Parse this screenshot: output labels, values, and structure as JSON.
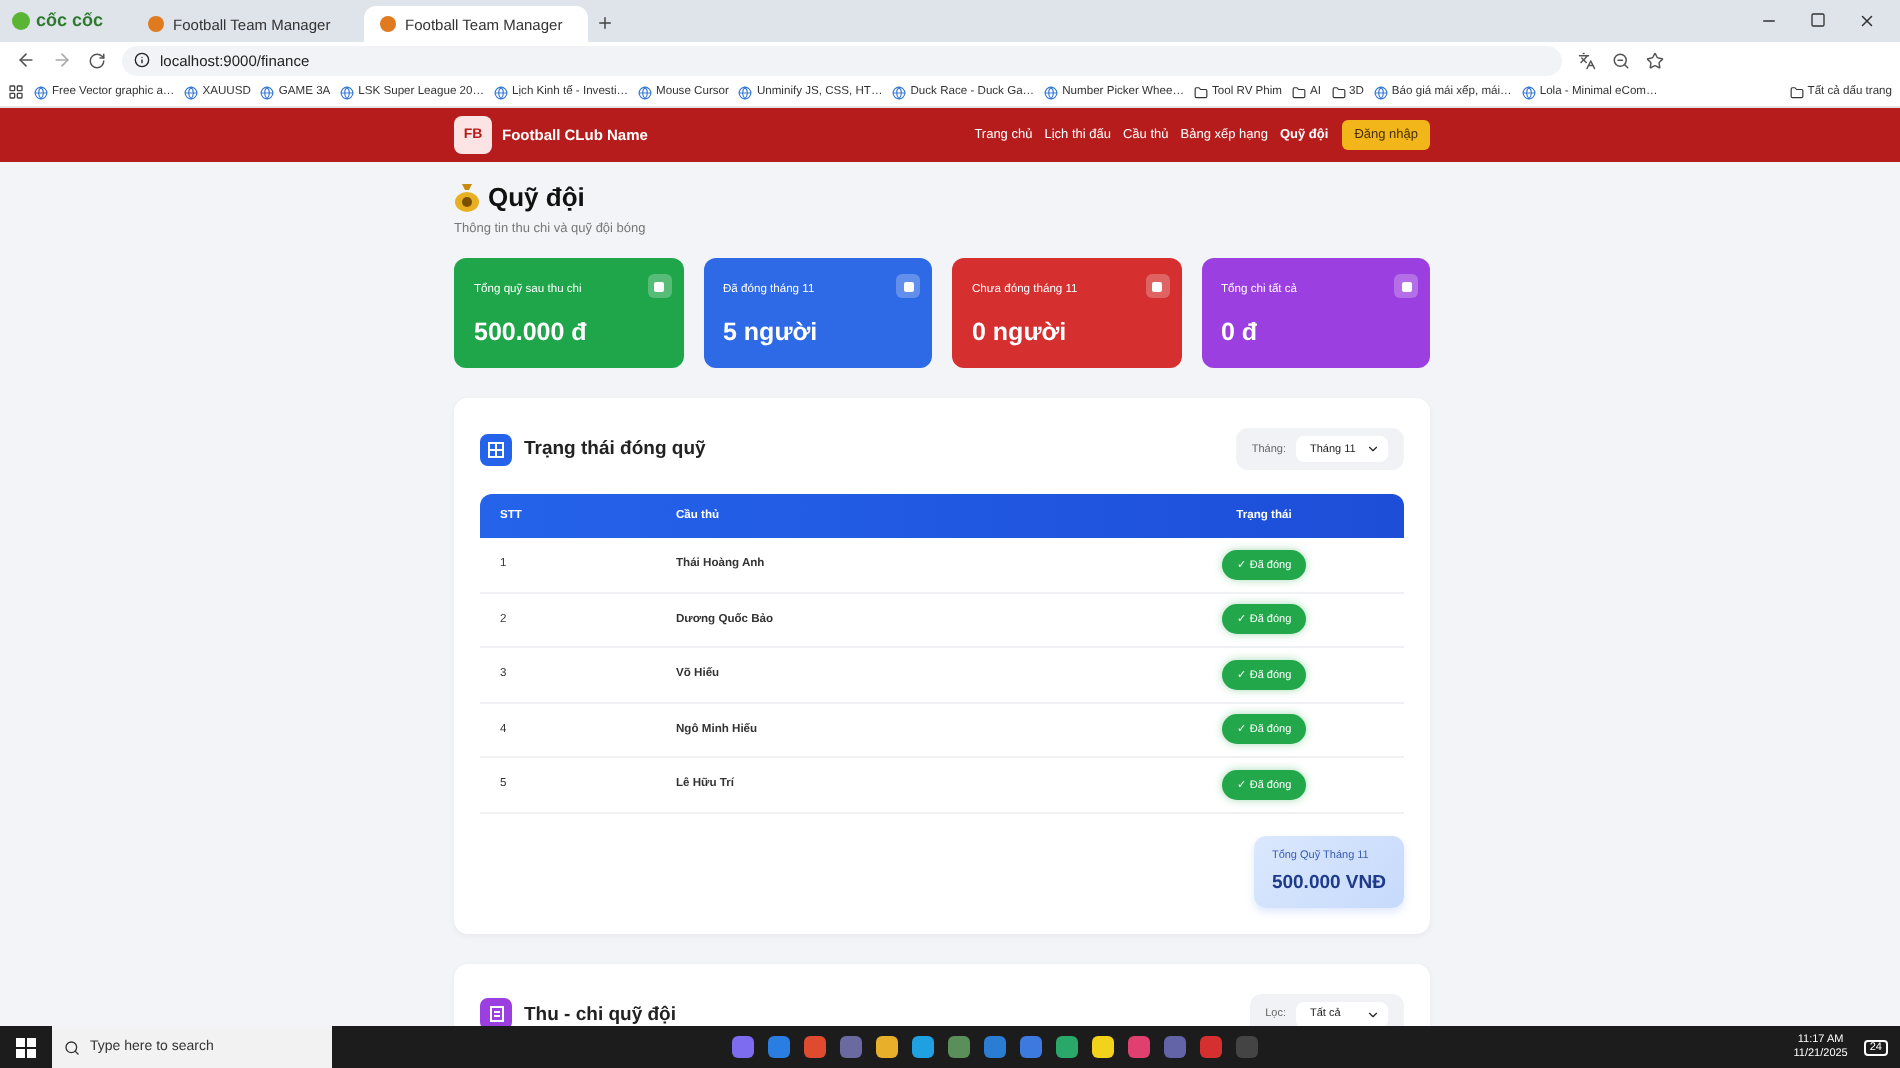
{
  "browser": {
    "brand": "cốc cốc",
    "tabs": [
      {
        "title": "Football Team Manager",
        "selected": false
      },
      {
        "title": "Football Team Manager",
        "selected": true
      }
    ],
    "url": "localhost:9000/finance",
    "bookmarks": [
      {
        "kind": "site",
        "label": "Free Vector graphic a…"
      },
      {
        "kind": "site",
        "label": "XAUUSD"
      },
      {
        "kind": "site",
        "label": "GAME 3A"
      },
      {
        "kind": "site",
        "label": "LSK Super League 20…"
      },
      {
        "kind": "site",
        "label": "Lịch Kinh tế - Investi…"
      },
      {
        "kind": "site",
        "label": "Mouse Cursor"
      },
      {
        "kind": "site",
        "label": "Unminify JS, CSS, HT…"
      },
      {
        "kind": "site",
        "label": "Duck Race - Duck Ga…"
      },
      {
        "kind": "site",
        "label": "Number Picker Whee…"
      },
      {
        "kind": "folder",
        "label": "Tool RV Phim"
      },
      {
        "kind": "folder",
        "label": "AI"
      },
      {
        "kind": "folder",
        "label": "3D"
      },
      {
        "kind": "site",
        "label": "Báo giá mái xếp, mái…"
      },
      {
        "kind": "site",
        "label": "Lola - Minimal eCom…"
      }
    ],
    "all_bookmarks": "Tất cả dấu trang"
  },
  "header": {
    "logo": "FB",
    "club_name": "Football CLub Name",
    "nav": [
      {
        "label": "Trang chủ",
        "selected": false
      },
      {
        "label": "Lịch thi đấu",
        "selected": false
      },
      {
        "label": "Cầu thủ",
        "selected": false
      },
      {
        "label": "Bảng xếp hạng",
        "selected": false
      },
      {
        "label": "Quỹ đội",
        "selected": true
      }
    ],
    "login": "Đăng nhập"
  },
  "page": {
    "title": "Quỹ đội",
    "subtitle": "Thông tin thu chi và quỹ đội bóng"
  },
  "stats": [
    {
      "label": "Tổng quỹ sau thu chi",
      "value": "500.000 đ",
      "color": "#1fa64a"
    },
    {
      "label": "Đã đóng tháng 11",
      "value": "5 người",
      "color": "#2f6ae6"
    },
    {
      "label": "Chưa đóng tháng 11",
      "value": "0 người",
      "color": "#d62f2f"
    },
    {
      "label": "Tổng chi tất cả",
      "value": "0 đ",
      "color": "#9b3fe0"
    }
  ],
  "status_section": {
    "title": "Trạng thái đóng quỹ",
    "filter_label": "Tháng:",
    "filter_value": "Tháng 11",
    "columns": [
      "STT",
      "Cầu thủ",
      "Trạng thái"
    ],
    "rows": [
      {
        "no": "1",
        "player": "Thái Hoàng Anh",
        "status": "✓ Đã đóng",
        "paid": true
      },
      {
        "no": "2",
        "player": "Dương Quốc Bảo",
        "status": "✓ Đã đóng",
        "paid": true
      },
      {
        "no": "3",
        "player": "Võ Hiếu",
        "status": "✓ Đã đóng",
        "paid": true
      },
      {
        "no": "4",
        "player": "Ngô Minh Hiếu",
        "status": "✓ Đã đóng",
        "paid": true
      },
      {
        "no": "5",
        "player": "Lê Hữu Trí",
        "status": "✓ Đã đóng",
        "paid": true
      }
    ],
    "total_label": "Tổng Quỹ Tháng 11",
    "total_value": "500.000 VNĐ"
  },
  "ledger_section": {
    "title": "Thu - chi quỹ đội",
    "filter_label": "Lọc:",
    "filter_value": "Tất cả"
  },
  "taskbar": {
    "search_placeholder": "Type here to search",
    "time": "11:17 AM",
    "date": "11/21/2025",
    "notifications": "24"
  }
}
